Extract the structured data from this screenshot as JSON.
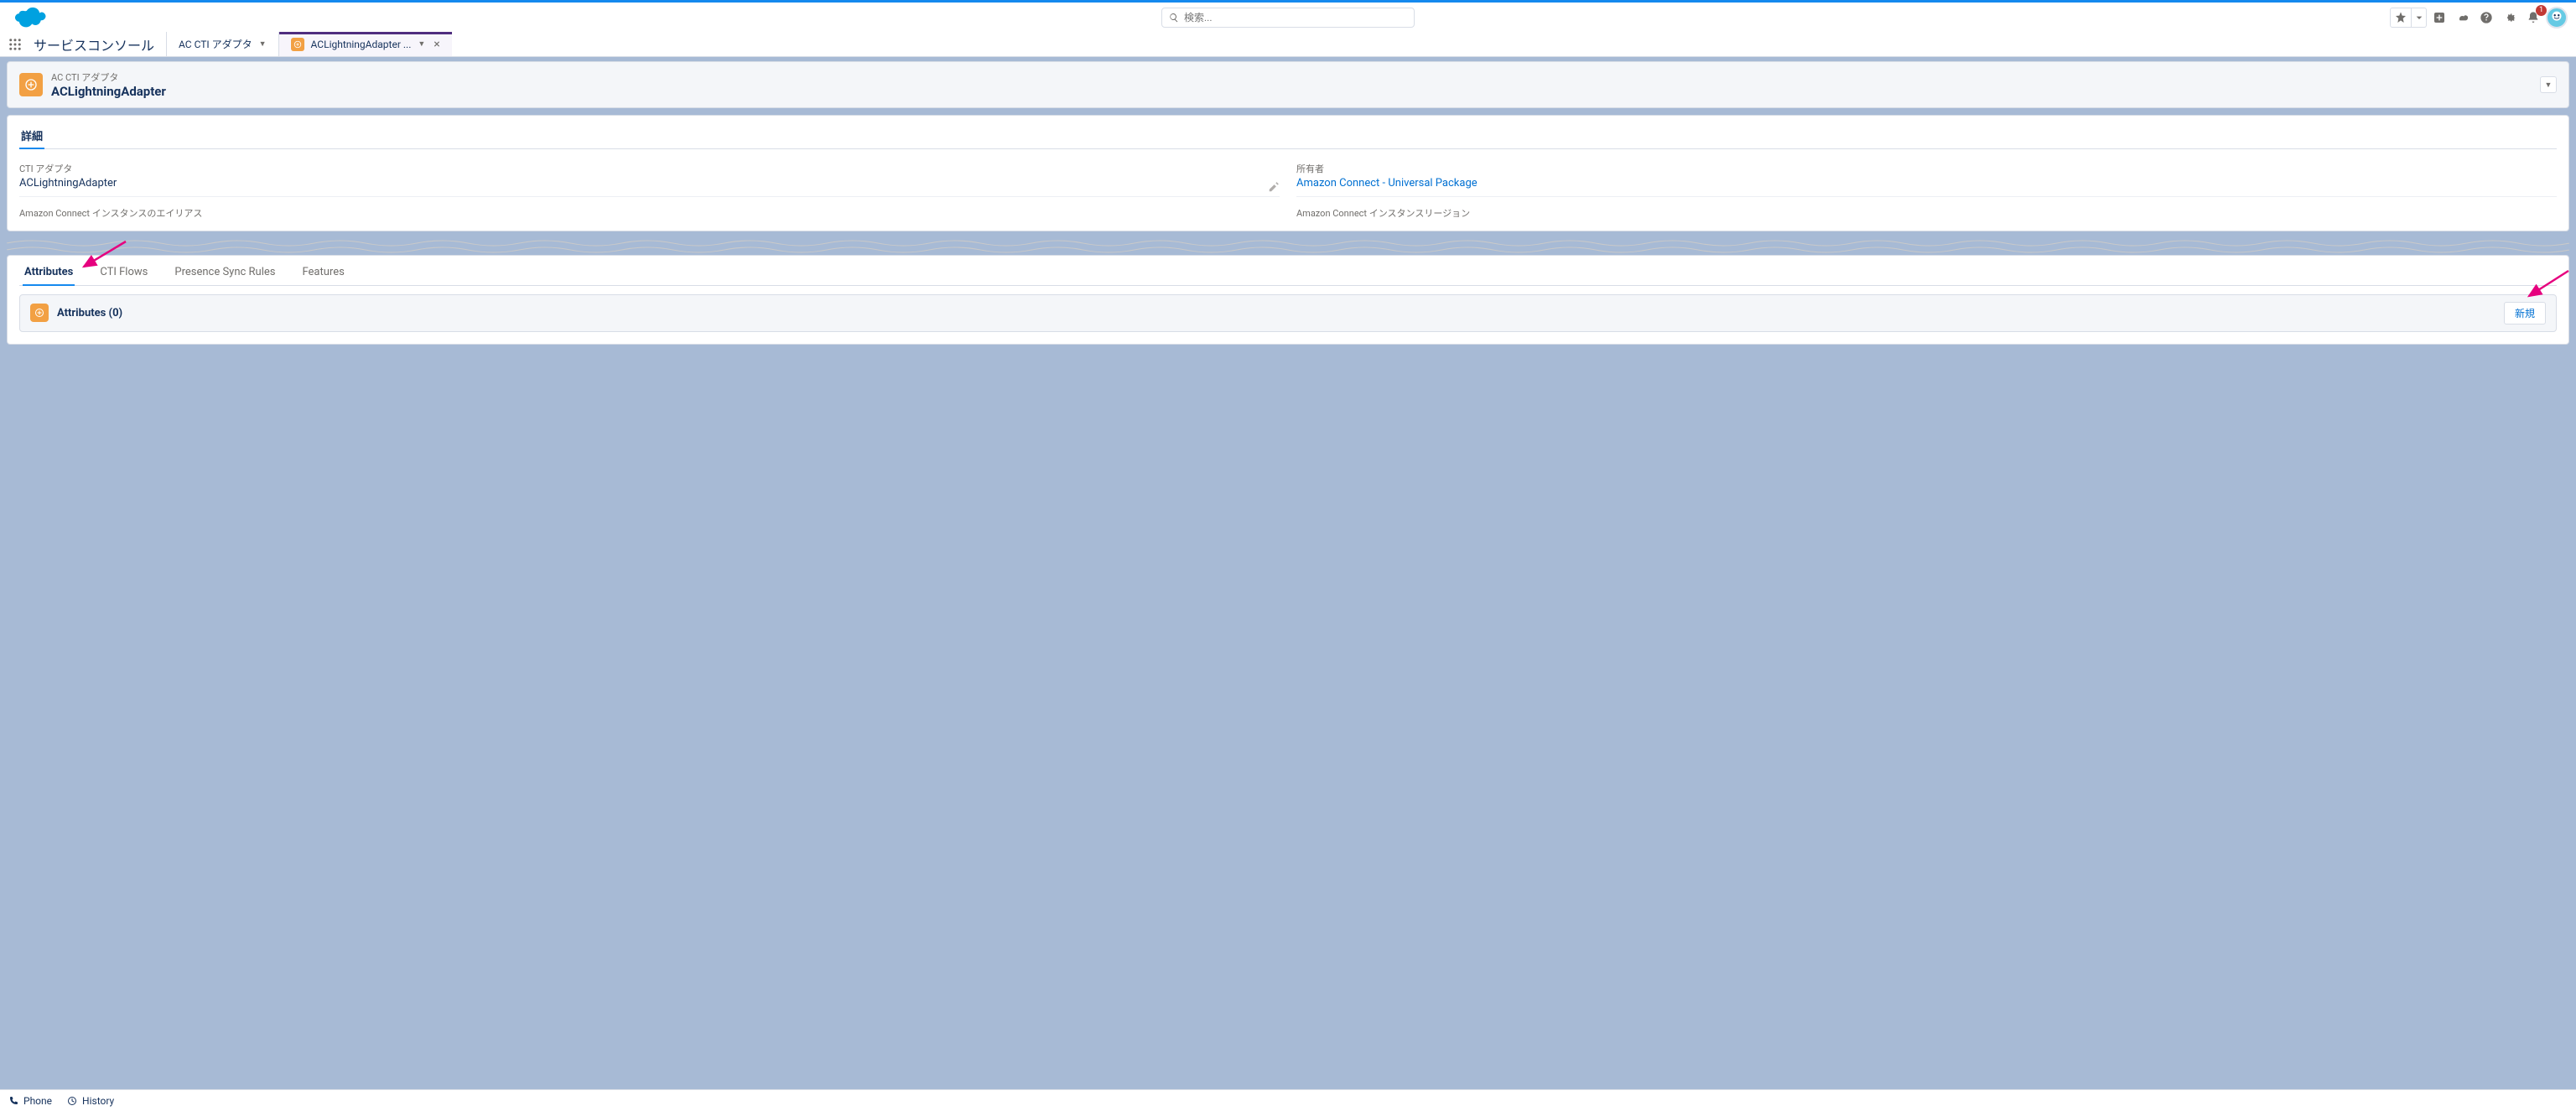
{
  "header": {
    "search_placeholder": "検索...",
    "notification_badge": "1"
  },
  "appbar": {
    "app_name": "サービスコンソール",
    "nav_items": [
      {
        "label": "AC CTI アダプタ"
      },
      {
        "label": "ACLightningAdapter ..."
      }
    ]
  },
  "record": {
    "object_label": "AC CTI アダプタ",
    "title": "ACLightningAdapter"
  },
  "detail_tab": {
    "label": "詳細",
    "fields": {
      "cti_adapter": {
        "label": "CTI アダプタ",
        "value": "ACLightningAdapter"
      },
      "alias": {
        "label": "Amazon Connect インスタンスのエイリアス"
      },
      "owner": {
        "label": "所有者",
        "value": "Amazon Connect - Universal Package"
      },
      "region": {
        "label": "Amazon Connect インスタンスリージョン"
      }
    }
  },
  "related": {
    "tabs": [
      "Attributes",
      "CTI Flows",
      "Presence Sync Rules",
      "Features"
    ],
    "panel_title": "Attributes (0)",
    "new_button": "新規"
  },
  "utility": {
    "phone": "Phone",
    "history": "History"
  }
}
